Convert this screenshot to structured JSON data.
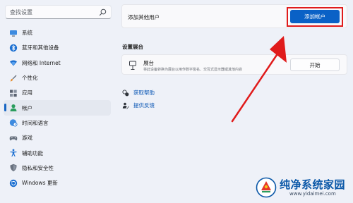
{
  "search": {
    "placeholder": "查找设置"
  },
  "sidebar": {
    "items": [
      {
        "label": "系统",
        "icon": "monitor-icon",
        "active": false
      },
      {
        "label": "蓝牙和其他设备",
        "icon": "bluetooth-icon",
        "active": false
      },
      {
        "label": "网络和 Internet",
        "icon": "wifi-icon",
        "active": false
      },
      {
        "label": "个性化",
        "icon": "paint-brush-icon",
        "active": false
      },
      {
        "label": "应用",
        "icon": "apps-icon",
        "active": false
      },
      {
        "label": "帐户",
        "icon": "person-icon",
        "active": true
      },
      {
        "label": "时间和语言",
        "icon": "globe-clock-icon",
        "active": false
      },
      {
        "label": "游戏",
        "icon": "gamepad-icon",
        "active": false
      },
      {
        "label": "辅助功能",
        "icon": "accessibility-icon",
        "active": false
      },
      {
        "label": "隐私和安全性",
        "icon": "shield-icon",
        "active": false
      },
      {
        "label": "Windows 更新",
        "icon": "windows-update-icon",
        "active": false
      }
    ]
  },
  "other_users": {
    "label": "添加其他用户",
    "add_button": "添加帐户"
  },
  "kiosk": {
    "section_title": "设置展台",
    "title": "展台",
    "description": "将此设备转换为展台以用作数字签名、交互式显示器或其他内容",
    "button": "开始"
  },
  "links": {
    "help": "获取帮助",
    "feedback": "提供反馈"
  },
  "watermark": {
    "text": "纯净系统家园",
    "url": "www.yidaimei.com"
  },
  "colors": {
    "accent": "#0a61c6",
    "annotation_red": "#e01b1b"
  }
}
